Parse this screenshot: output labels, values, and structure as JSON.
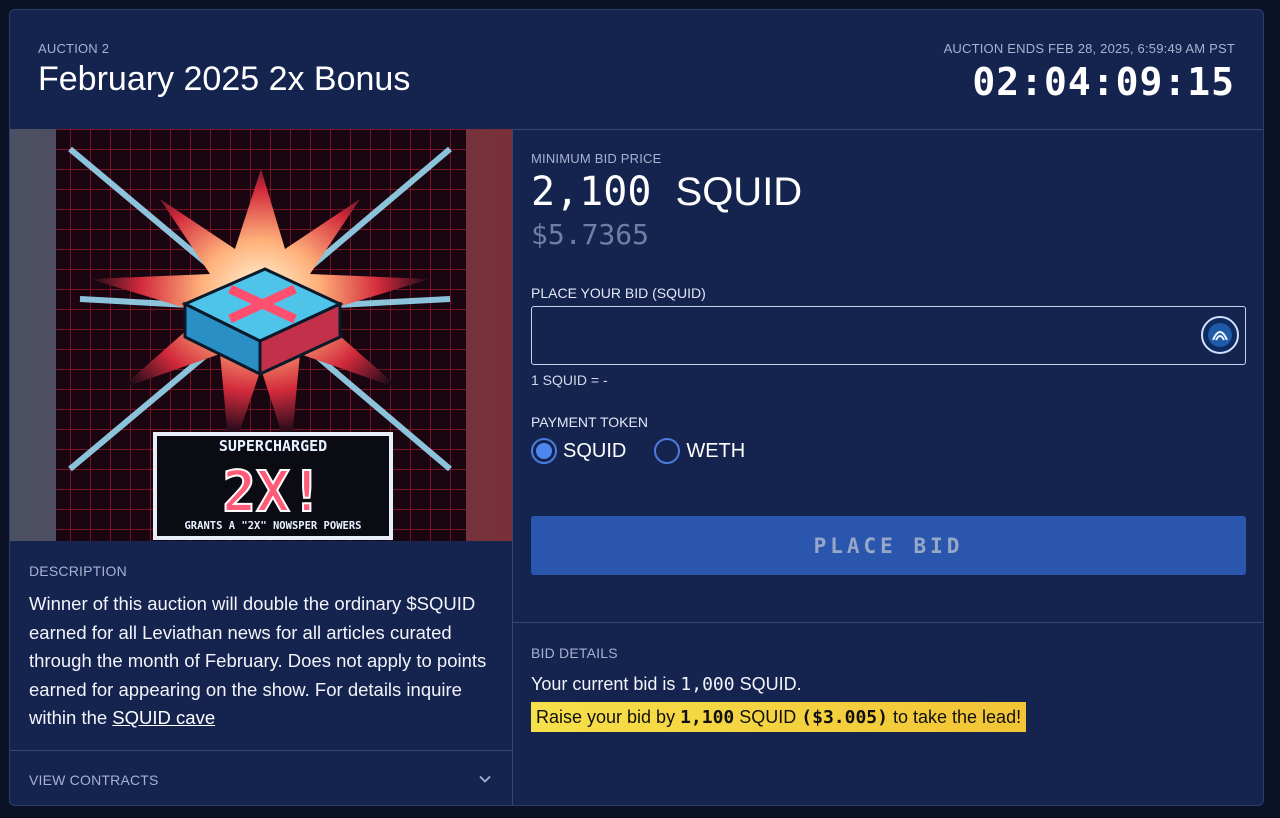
{
  "header": {
    "auction_label": "AUCTION 2",
    "title": "February 2025 2x Bonus",
    "ends_label": "AUCTION ENDS FEB 28, 2025, 6:59:49 AM PST",
    "countdown": "02:04:09:15"
  },
  "artwork": {
    "top_text": "SUPERCHARGED",
    "big_text": "2X!",
    "bottom_text": "GRANTS A \"2X\" NOWSPER POWERS"
  },
  "description": {
    "label": "DESCRIPTION",
    "text": "Winner of this auction will double the ordinary $SQUID earned for all Leviathan news for all articles curated through the month of February. Does not apply to points earned for appearing on the show. For details inquire within the ",
    "link": "SQUID cave"
  },
  "contracts": {
    "label": "VIEW CONTRACTS",
    "icon": "chevron-down-icon"
  },
  "bid": {
    "min_label": "MINIMUM BID PRICE",
    "min_value": "2,100",
    "min_unit": "SQUID",
    "min_usd": "$5.7365",
    "input_label": "PLACE YOUR BID (SQUID)",
    "input_value": "",
    "token_icon": "squid-token-icon",
    "rate": "1 SQUID = -",
    "payment_label": "PAYMENT TOKEN",
    "options": [
      {
        "label": "SQUID",
        "selected": true
      },
      {
        "label": "WETH",
        "selected": false
      }
    ],
    "button": "PLACE BID"
  },
  "details": {
    "label": "BID DETAILS",
    "current_prefix": "Your current bid is ",
    "current_value": "1,000",
    "current_suffix": " SQUID.",
    "raise_prefix": "Raise your bid by ",
    "raise_amount": "1,100",
    "raise_mid": " SQUID ",
    "raise_usd": "($3.005)",
    "raise_suffix": " to take the lead!"
  },
  "colors": {
    "background": "#0b1226",
    "card": "#15244f",
    "button": "#2b56ad",
    "highlight": "#f6e04a",
    "radio_selected": "#4d86f0"
  }
}
